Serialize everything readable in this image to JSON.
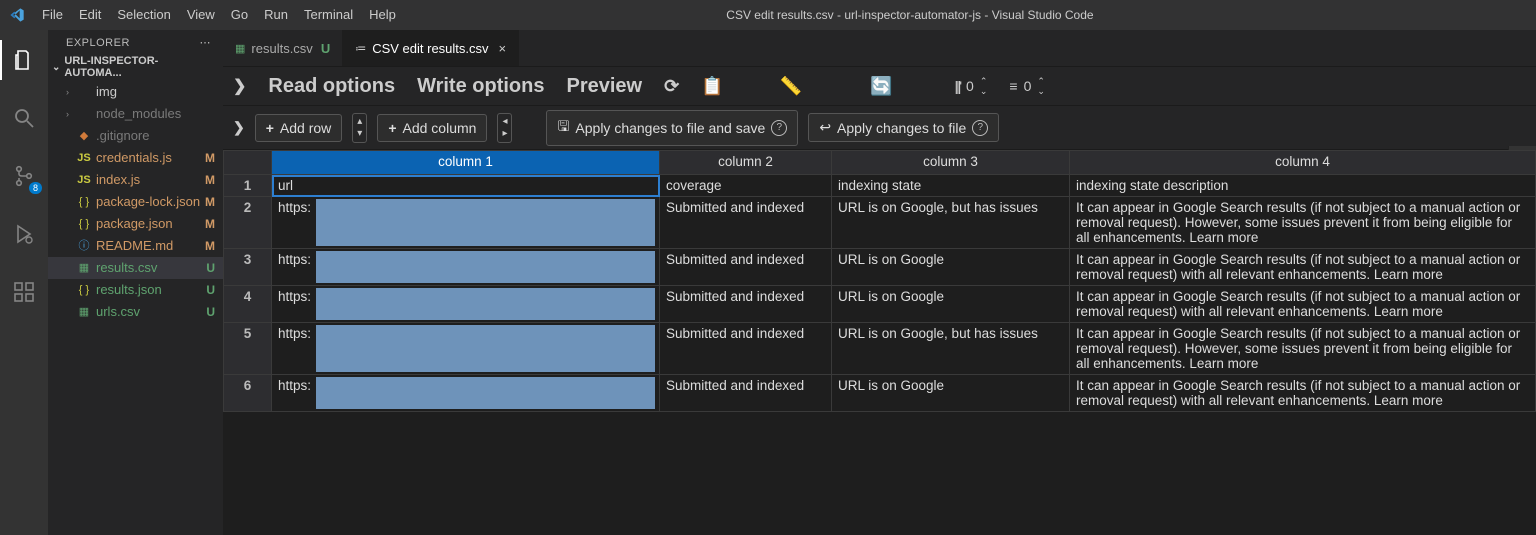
{
  "titlebar": {
    "menu": [
      "File",
      "Edit",
      "Selection",
      "View",
      "Go",
      "Run",
      "Terminal",
      "Help"
    ],
    "title": "CSV edit results.csv - url-inspector-automator-js - Visual Studio Code"
  },
  "activitybar": {
    "scm_badge": "8"
  },
  "sidebar": {
    "title": "EXPLORER",
    "section": "URL-INSPECTOR-AUTOMA...",
    "files": [
      {
        "name": "img",
        "type": "folder",
        "dim": false
      },
      {
        "name": "node_modules",
        "type": "folder",
        "dim": true
      },
      {
        "name": ".gitignore",
        "type": "git",
        "dim": true
      },
      {
        "name": "credentials.js",
        "type": "js",
        "status": "M"
      },
      {
        "name": "index.js",
        "type": "js",
        "status": "M"
      },
      {
        "name": "package-lock.json",
        "type": "json",
        "status": "M"
      },
      {
        "name": "package.json",
        "type": "json",
        "status": "M"
      },
      {
        "name": "README.md",
        "type": "info",
        "status": "M"
      },
      {
        "name": "results.csv",
        "type": "csv",
        "status": "U",
        "selected": true
      },
      {
        "name": "results.json",
        "type": "json",
        "status": "U"
      },
      {
        "name": "urls.csv",
        "type": "csv",
        "status": "U"
      }
    ]
  },
  "tabs": [
    {
      "label": "results.csv",
      "icon": "csv",
      "status": "U",
      "active": false,
      "close": false
    },
    {
      "label": "CSV edit results.csv",
      "icon": "csvedit",
      "active": true,
      "close": true
    }
  ],
  "toolbar1": {
    "read": "Read options",
    "write": "Write options",
    "preview": "Preview",
    "val1": "0",
    "val2": "0"
  },
  "toolbar2": {
    "addrow": "Add row",
    "addcol": "Add column",
    "apply_save": "Apply changes to file and save",
    "apply": "Apply changes to file"
  },
  "grid": {
    "columns": [
      "column 1",
      "column 2",
      "column 3",
      "column 4"
    ],
    "header_row": [
      "url",
      "coverage",
      "indexing state",
      "indexing state description"
    ],
    "rows": [
      [
        "https:",
        "Submitted and indexed",
        "URL is on Google, but has issues",
        "It can appear in Google Search results (if not subject to a manual action or removal request). However, some issues prevent it from being eligible for all enhancements. Learn more"
      ],
      [
        "https:",
        "Submitted and indexed",
        "URL is on Google",
        "It can appear in Google Search results (if not subject to a manual action or removal request) with all relevant enhancements. Learn more"
      ],
      [
        "https:",
        "Submitted and indexed",
        "URL is on Google",
        "It can appear in Google Search results (if not subject to a manual action or removal request) with all relevant enhancements. Learn more"
      ],
      [
        "https:",
        "Submitted and indexed",
        "URL is on Google, but has issues",
        "It can appear in Google Search results (if not subject to a manual action or removal request). However, some issues prevent it from being eligible for all enhancements. Learn more"
      ],
      [
        "https:",
        "Submitted and indexed",
        "URL is on Google",
        "It can appear in Google Search results (if not subject to a manual action or removal request) with all relevant enhancements. Learn more"
      ]
    ]
  }
}
